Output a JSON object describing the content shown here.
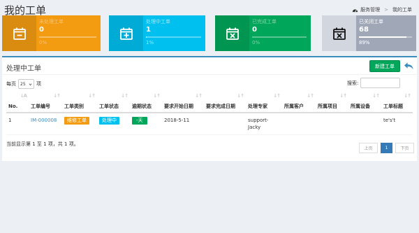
{
  "page_title": "我的工单",
  "breadcrumb": {
    "parent": "服务管理",
    "current": "我的工单"
  },
  "stats": [
    {
      "label": "未处理工单",
      "value": "0",
      "percent_text": "0%",
      "progress": 0,
      "icon": "calendar-minus-icon"
    },
    {
      "label": "处理中工单",
      "value": "1",
      "percent_text": "1%",
      "progress": 0.01,
      "icon": "calendar-plus-icon"
    },
    {
      "label": "已完成工单",
      "value": "0",
      "percent_text": "0%",
      "progress": 0,
      "icon": "calendar-times-icon"
    },
    {
      "label": "已关闭工单",
      "value": "68",
      "percent_text": "89%",
      "progress": 0.89,
      "icon": "calendar-close-icon"
    }
  ],
  "box": {
    "title": "处理中工单",
    "new_button": "新建工单"
  },
  "table_controls": {
    "length_prefix": "每页",
    "length_value": "25",
    "length_suffix": "项",
    "search_label": "搜索:",
    "search_value": ""
  },
  "table": {
    "headers": [
      "No.",
      "工单编号",
      "工单类别",
      "工单状态",
      "逾期状态",
      "要求开始日期",
      "要求完成日期",
      "处理专家",
      "所属客户",
      "所属项目",
      "所属设备",
      "工单标题"
    ],
    "rows": [
      {
        "no": "1",
        "id": "IM-000008",
        "category": "维修工单",
        "status": "处理中",
        "overdue": "-天",
        "start_date": "2018-5-11",
        "end_date": "",
        "expert": "support-Jacky",
        "customer": "",
        "project": "",
        "device": "",
        "title": "te's't"
      }
    ]
  },
  "info_text": "当前显示第 1 至 1 项，共 1 项。",
  "pager": {
    "prev": "上页",
    "current": "1",
    "next": "下页"
  },
  "colors": {
    "orange": "#f39c12",
    "aqua": "#00c0ef",
    "green": "#00a65a",
    "gray": "#a0a8b8",
    "primary": "#3c8dbc"
  }
}
